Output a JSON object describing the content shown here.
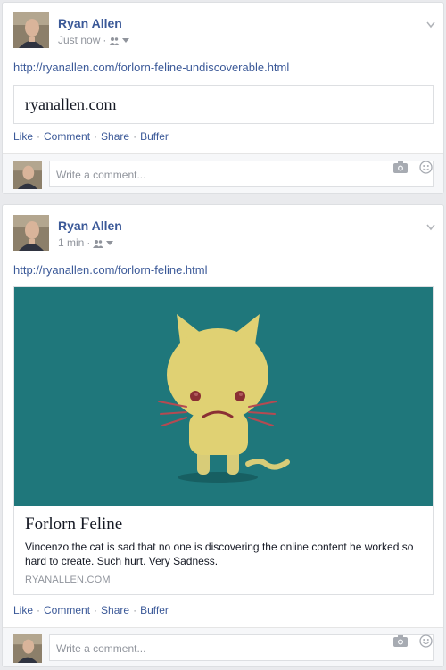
{
  "posts": [
    {
      "author": "Ryan Allen",
      "time": "Just now",
      "url": "http://ryanallen.com/forlorn-feline-undiscoverable.html",
      "card": {
        "site": "ryanallen.com"
      },
      "actions": [
        "Like",
        "Comment",
        "Share",
        "Buffer"
      ],
      "comment_placeholder": "Write a comment..."
    },
    {
      "author": "Ryan Allen",
      "time": "1 min",
      "url": "http://ryanallen.com/forlorn-feline.html",
      "card": {
        "title": "Forlorn Feline",
        "description": "Vincenzo the cat is sad that no one is discovering the online content he worked so hard to create. Such hurt. Very Sadness.",
        "domain": "RYANALLEN.COM"
      },
      "actions": [
        "Like",
        "Comment",
        "Share",
        "Buffer"
      ],
      "comment_placeholder": "Write a comment..."
    }
  ],
  "icons": {
    "audience": "friends-icon",
    "menu": "chevron-down-icon",
    "camera": "camera-icon",
    "emoji": "smiley-icon"
  },
  "colors": {
    "link": "#3b5998",
    "muted": "#90949c",
    "card_bg": "#1f777b",
    "cat": "#e0d173"
  }
}
